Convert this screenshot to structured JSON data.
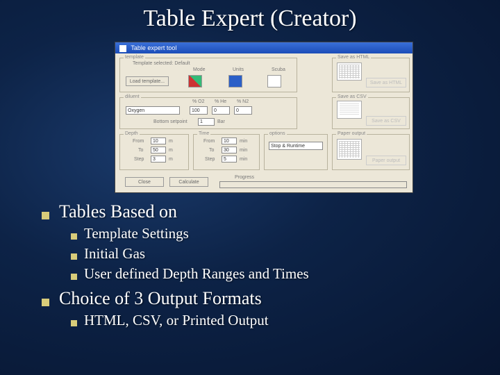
{
  "slide": {
    "title": "Table Expert (Creator)"
  },
  "window": {
    "title": "Table expert tool",
    "template_group": "template",
    "template_selected_label": "Template selected:",
    "template_selected_value": "Default",
    "load_template_btn": "Load template...",
    "mode_label": "Mode",
    "units_label": "Units",
    "scuba_label": "Scuba",
    "diluent_group": "diluent",
    "diluent_value": "Oxygen",
    "pct_o2": "% O2",
    "pct_he": "% He",
    "pct_n2": "% N2",
    "val_o2": "100",
    "val_he": "0",
    "val_n2": "0",
    "bottom_setpoint_label": "Bottom setpoint",
    "bottom_setpoint_val": "1",
    "bottom_setpoint_unit": "Bar",
    "depth_group": "Depth",
    "time_group": "Time",
    "from_label": "From",
    "to_label": "To",
    "step_label": "Step",
    "depth_from": "10",
    "depth_to": "50",
    "depth_step": "3",
    "depth_unit": "m",
    "time_from": "10",
    "time_to": "30",
    "time_step": "5",
    "time_unit": "min",
    "options_group": "options",
    "options_value": "Stop & Runtime",
    "save_html_group": "Save as HTML",
    "save_html_btn": "Save as HTML",
    "save_csv_group": "Save as CSV",
    "save_csv_btn": "Save as CSV",
    "paper_group": "Paper output",
    "paper_btn": "Paper output",
    "close_btn": "Close",
    "calculate_btn": "Calculate",
    "progress_label": "Progress"
  },
  "bullets": {
    "b1": "Tables Based on",
    "b1a": "Template Settings",
    "b1b": "Initial Gas",
    "b1c": "User defined Depth Ranges and Times",
    "b2": "Choice of 3 Output Formats",
    "b2a": "HTML, CSV, or Printed Output"
  }
}
